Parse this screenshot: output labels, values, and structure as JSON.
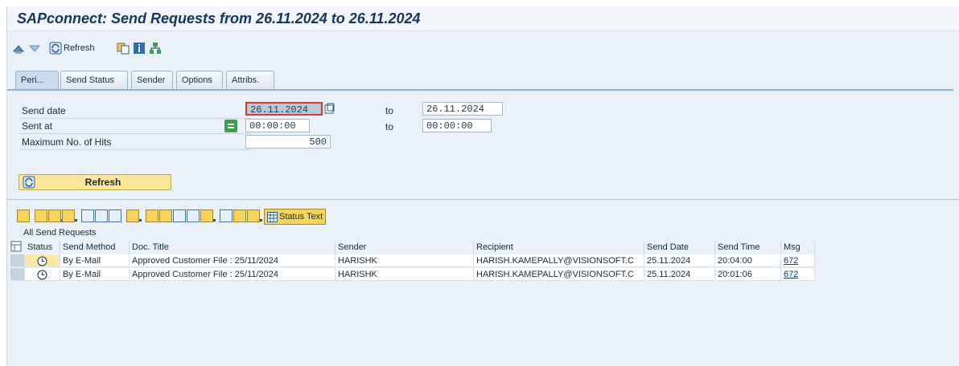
{
  "title": "SAPconnect: Send Requests from 26.11.2024 to 26.11.2024",
  "app_toolbar": {
    "refresh_label": "Refresh"
  },
  "tabs": [
    {
      "label": "Peri...",
      "active": true
    },
    {
      "label": "Send Status",
      "active": false
    },
    {
      "label": "Sender",
      "active": false
    },
    {
      "label": "Options",
      "active": false
    },
    {
      "label": "Attribs.",
      "active": false
    }
  ],
  "selection": {
    "send_date_label": "Send date",
    "send_date_from": "26.11.2024",
    "send_date_to": "26.11.2024",
    "sent_at_label": "Sent at",
    "sent_at_from": "00:00:00",
    "sent_at_to": "00:00:00",
    "max_hits_label": "Maximum No. of Hits",
    "max_hits": "500",
    "to_label": "to"
  },
  "refresh_button_label": "Refresh",
  "alv_toolbar": {
    "status_text_label": "Status Text"
  },
  "grid": {
    "title": "All Send Requests",
    "columns": [
      "Status",
      "Send Method",
      "Doc. Title",
      "Sender",
      "Recipient",
      "Send Date",
      "Send Time",
      "Msg"
    ],
    "rows": [
      {
        "send_method": "By E-Mail",
        "doc_title": "Approved Customer File : 25/11/2024",
        "sender": "HARISHK",
        "recipient": "HARISH.KAMEPALLY@VISIONSOFT.C",
        "send_date": "25.11.2024",
        "send_time": "20:04:00",
        "msg": "672"
      },
      {
        "send_method": "By E-Mail",
        "doc_title": "Approved Customer File : 25/11/2024",
        "sender": "HARISHK",
        "recipient": "HARISH.KAMEPALLY@VISIONSOFT.C",
        "send_date": "25.11.2024",
        "send_time": "20:01:06",
        "msg": "672"
      }
    ]
  },
  "colors": {
    "title": "#17365a",
    "panel_bg": "#eaf0f7",
    "button_yellow": "#fbe69a",
    "status_cell": "#fde8a8"
  }
}
